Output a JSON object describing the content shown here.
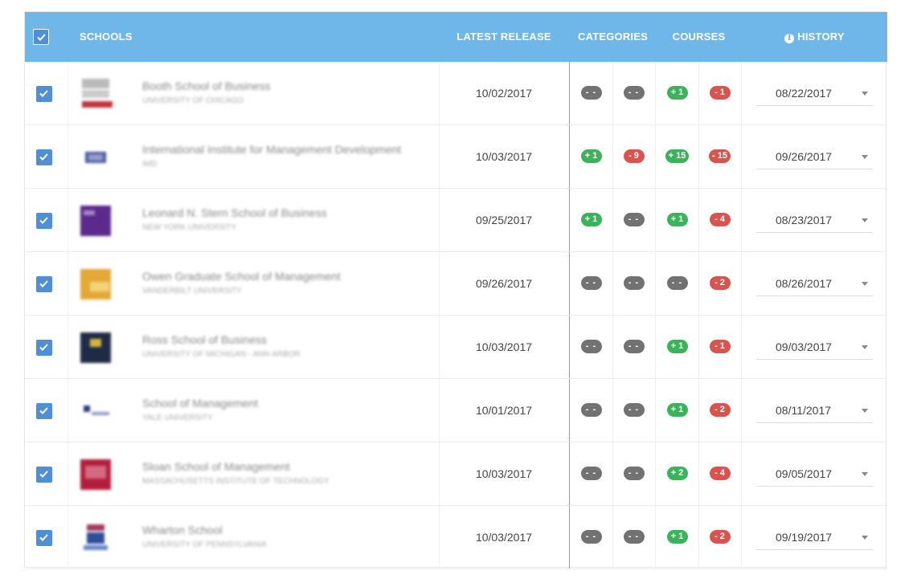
{
  "header": {
    "schools": "SCHOOLS",
    "latest_release": "LATEST RELEASE",
    "categories": "CATEGORIES",
    "courses": "COURSES",
    "history": "HISTORY"
  },
  "colors": {
    "header_bg": "#70b7e9",
    "checkbox": "#4f8fd4",
    "positive": "#3cb35a",
    "negative": "#d9534f",
    "neutral": "#727272"
  },
  "rows": [
    {
      "name": "Booth School of Business",
      "sub": "University of Chicago",
      "release": "10/02/2017",
      "cat1": "- -",
      "cat2": "- -",
      "cou1": "+ 1",
      "cou2": "- 1",
      "history": "08/22/2017"
    },
    {
      "name": "International Institute for Management Development",
      "sub": "IMD",
      "release": "10/03/2017",
      "cat1": "+ 1",
      "cat2": "- 9",
      "cou1": "+ 15",
      "cou2": "- 15",
      "history": "09/26/2017"
    },
    {
      "name": "Leonard N. Stern School of Business",
      "sub": "New York University",
      "release": "09/25/2017",
      "cat1": "+ 1",
      "cat2": "- -",
      "cou1": "+ 1",
      "cou2": "- 4",
      "history": "08/23/2017"
    },
    {
      "name": "Owen Graduate School of Management",
      "sub": "Vanderbilt University",
      "release": "09/26/2017",
      "cat1": "- -",
      "cat2": "- -",
      "cou1": "- -",
      "cou2": "- 2",
      "history": "08/26/2017"
    },
    {
      "name": "Ross School of Business",
      "sub": "University of Michigan - Ann Arbor",
      "release": "10/03/2017",
      "cat1": "- -",
      "cat2": "- -",
      "cou1": "+ 1",
      "cou2": "- 1",
      "history": "09/03/2017"
    },
    {
      "name": "School of Management",
      "sub": "Yale University",
      "release": "10/01/2017",
      "cat1": "- -",
      "cat2": "- -",
      "cou1": "+ 1",
      "cou2": "- 2",
      "history": "08/11/2017"
    },
    {
      "name": "Sloan School of Management",
      "sub": "Massachusetts Institute of Technology",
      "release": "10/03/2017",
      "cat1": "- -",
      "cat2": "- -",
      "cou1": "+ 2",
      "cou2": "- 4",
      "history": "09/05/2017"
    },
    {
      "name": "Wharton School",
      "sub": "University of Pennsylvania",
      "release": "10/03/2017",
      "cat1": "- -",
      "cat2": "- -",
      "cou1": "+ 1",
      "cou2": "- 2",
      "history": "09/19/2017"
    }
  ]
}
